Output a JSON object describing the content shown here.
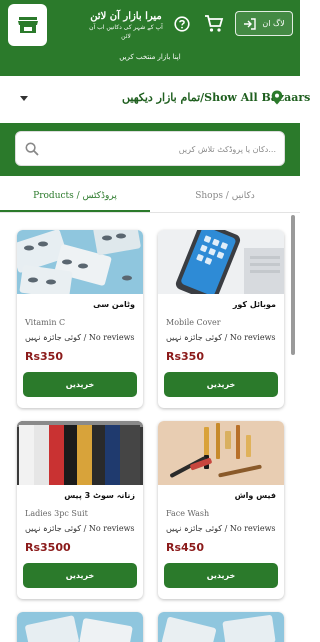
{
  "header": {
    "brand_title": "میرا بازار آن لائن",
    "brand_subtitle": "آپ کے شہر کی دکانیں اب آن لائن",
    "login_label": "لاگ ان",
    "select_bazaar": "اپنا بازار منتخب کریں"
  },
  "bazaar": {
    "label": "تمام بازار دیکھیں/Show All Bazaars"
  },
  "search": {
    "placeholder": "دکان یا پروڈکٹ تلاش کریں..."
  },
  "tabs": [
    {
      "label": "Products / پروڈکٹس",
      "active": true
    },
    {
      "label": "Shops / دکانیں",
      "active": false
    }
  ],
  "products": [
    {
      "name_ur": "وٹامن سی",
      "name_en": "Vitamin C",
      "reviews": "کوئی جائزہ نہیں / No reviews",
      "price": "Rs350",
      "buy_label": "خریدیں",
      "image": "pills"
    },
    {
      "name_ur": "موبائل کور",
      "name_en": "Mobile Cover",
      "reviews": "کوئی جائزہ نہیں / No reviews",
      "price": "Rs350",
      "buy_label": "خریدیں",
      "image": "phone"
    },
    {
      "name_ur": "زنانہ سوٹ 3 پیس",
      "name_en": "Ladies 3pc Suit",
      "reviews": "کوئی جائزہ نہیں / No reviews",
      "price": "Rs3500",
      "buy_label": "خریدیں",
      "image": "clothes"
    },
    {
      "name_ur": "فیس واش",
      "name_en": "Face Wash",
      "reviews": "کوئی جائزہ نہیں / No reviews",
      "price": "Rs450",
      "buy_label": "خریدیں",
      "image": "cosmetics"
    }
  ],
  "colors": {
    "primary": "#2b7a2b",
    "price": "#8b1a1a"
  },
  "icons": {
    "logo": "store-icon",
    "help": "help-circle-icon",
    "cart": "cart-icon",
    "login": "login-icon",
    "location": "map-pin-icon",
    "search": "search-icon"
  }
}
